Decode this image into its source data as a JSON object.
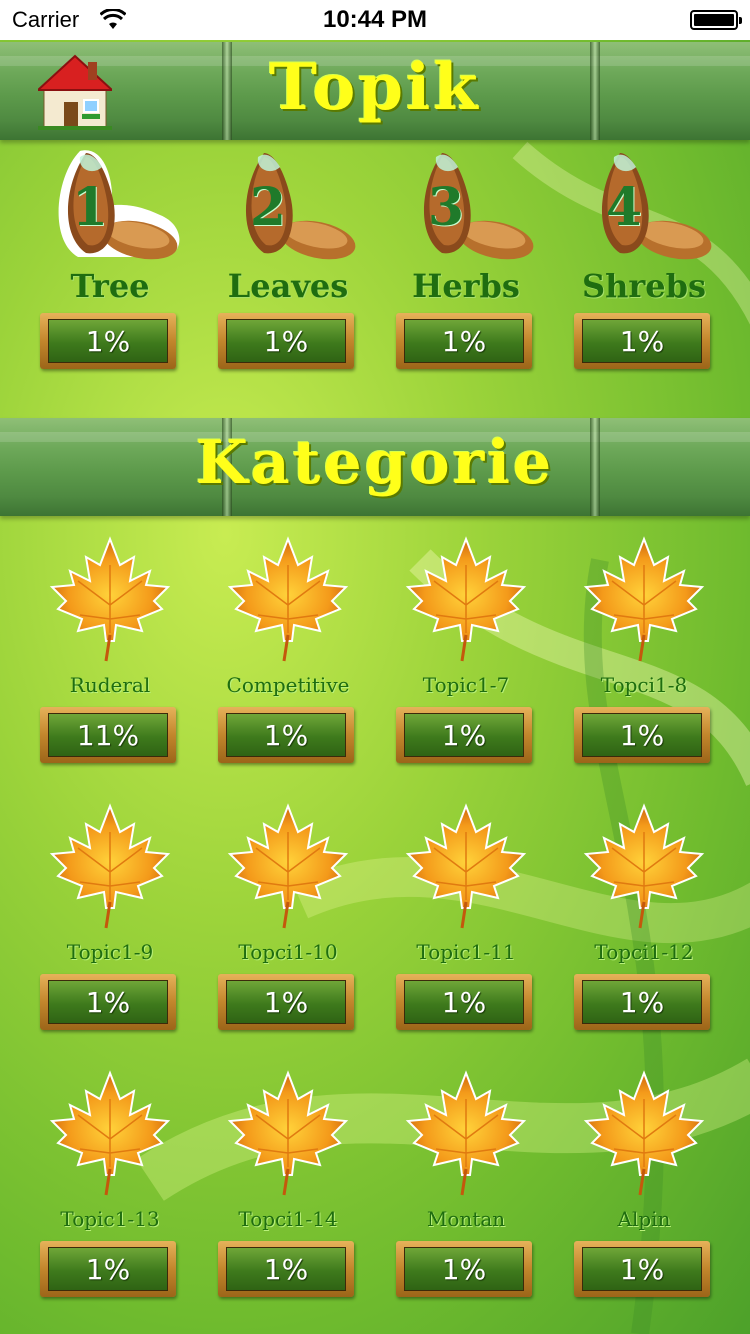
{
  "status_bar": {
    "carrier": "Carrier",
    "time": "10:44 PM"
  },
  "header": {
    "title": "Topik",
    "home_icon": "house-icon"
  },
  "topics": [
    {
      "number": "1",
      "label": "Tree",
      "progress": "1%",
      "selected": true
    },
    {
      "number": "2",
      "label": "Leaves",
      "progress": "1%",
      "selected": false
    },
    {
      "number": "3",
      "label": "Herbs",
      "progress": "1%",
      "selected": false
    },
    {
      "number": "4",
      "label": "Shrebs",
      "progress": "1%",
      "selected": false
    }
  ],
  "categories_header": {
    "title": "Kategorie"
  },
  "categories": [
    {
      "label": "Ruderal",
      "progress": "11%"
    },
    {
      "label": "Competitive",
      "progress": "1%"
    },
    {
      "label": "Topic1-7",
      "progress": "1%"
    },
    {
      "label": "Topci1-8",
      "progress": "1%"
    },
    {
      "label": "Topic1-9",
      "progress": "1%"
    },
    {
      "label": "Topci1-10",
      "progress": "1%"
    },
    {
      "label": "Topic1-11",
      "progress": "1%"
    },
    {
      "label": "Topci1-12",
      "progress": "1%"
    },
    {
      "label": "Topic1-13",
      "progress": "1%"
    },
    {
      "label": "Topci1-14",
      "progress": "1%"
    },
    {
      "label": "Montan",
      "progress": "1%"
    },
    {
      "label": "Alpin",
      "progress": "1%"
    }
  ],
  "colors": {
    "title_yellow": "#ffff1a",
    "label_green": "#1f6d10",
    "plate_wood": "#c2862c",
    "plate_green": "#3e7a1c"
  }
}
